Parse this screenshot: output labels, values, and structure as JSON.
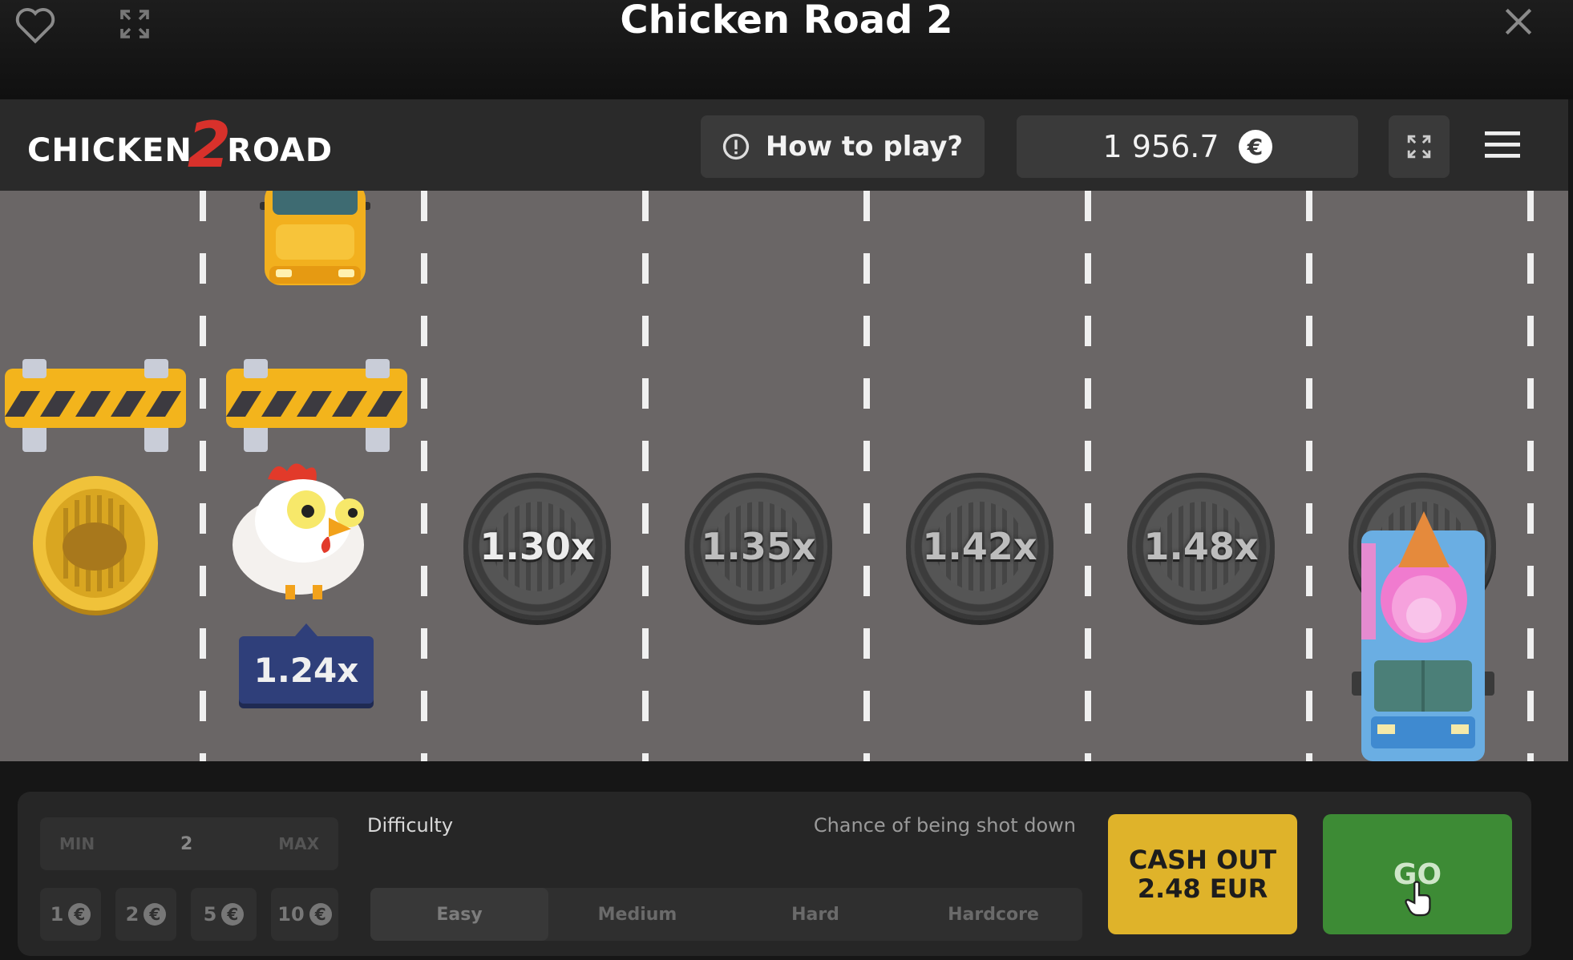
{
  "window": {
    "title": "Chicken Road 2"
  },
  "game": {
    "logo": {
      "part1": "CHICKEN",
      "part2": "2",
      "part3": "ROAD"
    },
    "how_to_play": "How to play?",
    "balance": "1 956.7",
    "currency_symbol": "€"
  },
  "road": {
    "current_multiplier": "1.24x",
    "multipliers": [
      "1.30x",
      "1.35x",
      "1.42x",
      "1.48x"
    ]
  },
  "controls": {
    "bet": {
      "min_label": "MIN",
      "value": "2",
      "max_label": "MAX"
    },
    "quick_bets": [
      "1",
      "2",
      "5",
      "10"
    ],
    "difficulty_label": "Difficulty",
    "chance_label": "Chance of being shot down",
    "difficulties": [
      "Easy",
      "Medium",
      "Hard",
      "Hardcore"
    ],
    "selected_difficulty": "Easy",
    "cashout": {
      "line1": "CASH OUT",
      "line2": "2.48 EUR"
    },
    "go_label": "GO"
  },
  "colors": {
    "cashout": "#dfb32a",
    "go": "#3d8b35",
    "road": "#6a6666"
  }
}
